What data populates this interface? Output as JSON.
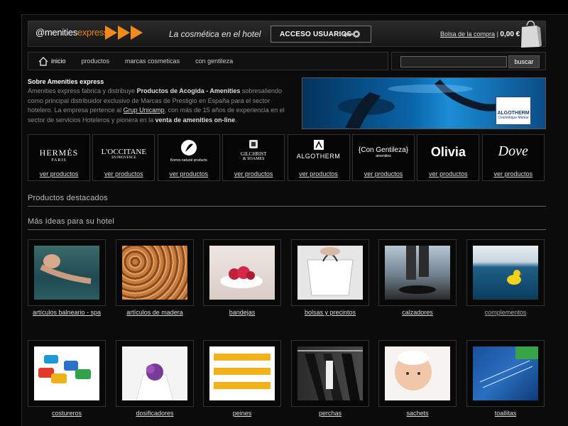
{
  "header": {
    "logo_at": "@menities",
    "logo_brand": "express",
    "tagline": "La cosmética en el hotel",
    "access_label": "ACCESO USUARIOS",
    "cart_link": "Bolsa de la compra",
    "cart_sep": "|",
    "cart_amount": "0,00 €"
  },
  "nav": {
    "items": [
      "inicio",
      "productos",
      "marcas cosmeticas",
      "con gentileza"
    ]
  },
  "search": {
    "placeholder": "",
    "button": "buscar"
  },
  "about": {
    "title": "Sobre Amenities express",
    "p1": "Amenities express fabrica y distribuye ",
    "b1": "Productos de Acogida - Amenities",
    "p2": " sobresaliendo como principal distribuidor exclusivo de Marcas de Prestigio en España para el sector hotelero. La empresa pertence al ",
    "link": "Grup Unicamp",
    "p3": ", con más de 15 años de experiencia en el sector de servicios Hoteleros y pionera en la ",
    "b2": "venta de amenities on-line",
    "p4": "."
  },
  "banner": {
    "badge_title": "ALGOTHERM",
    "badge_sub": "Cosmétique Marine"
  },
  "brands": [
    {
      "name": "HERMÈS",
      "sub": "PARIS",
      "link": "ver productos"
    },
    {
      "name": "L'OCCITANE",
      "sub": "EN PROVENCE",
      "link": "ver productos"
    },
    {
      "name": "Korres natural products",
      "sub": "",
      "link": "ver productos"
    },
    {
      "name": "GILCHRIST",
      "sub": "& SOAMES",
      "link": "ver productos"
    },
    {
      "name": "ALGOTHERM",
      "sub": "",
      "link": "ver productos"
    },
    {
      "name": "{Con Gentileza}",
      "sub": "amenities",
      "link": "ver productos"
    },
    {
      "name": "Olivia",
      "sub": "",
      "link": "ver productos"
    },
    {
      "name": "Dove",
      "sub": "",
      "link": "ver productos"
    }
  ],
  "sections": {
    "featured": "Productos destacados",
    "ideas": "Más Ideas para su hotel"
  },
  "products": [
    {
      "label": "artículos balneario - spa"
    },
    {
      "label": "artículos de madera"
    },
    {
      "label": "bandejas"
    },
    {
      "label": "bolsas y precintos"
    },
    {
      "label": "calzadores"
    },
    {
      "label": "complementos"
    },
    {
      "label": "costureros"
    },
    {
      "label": "dosificadores"
    },
    {
      "label": "peines"
    },
    {
      "label": "perchas"
    },
    {
      "label": "sachets"
    },
    {
      "label": "toallitas"
    }
  ],
  "colors": {
    "accent": "#f08a1c",
    "background": "#0b0b0b",
    "link": "#dddddd"
  }
}
